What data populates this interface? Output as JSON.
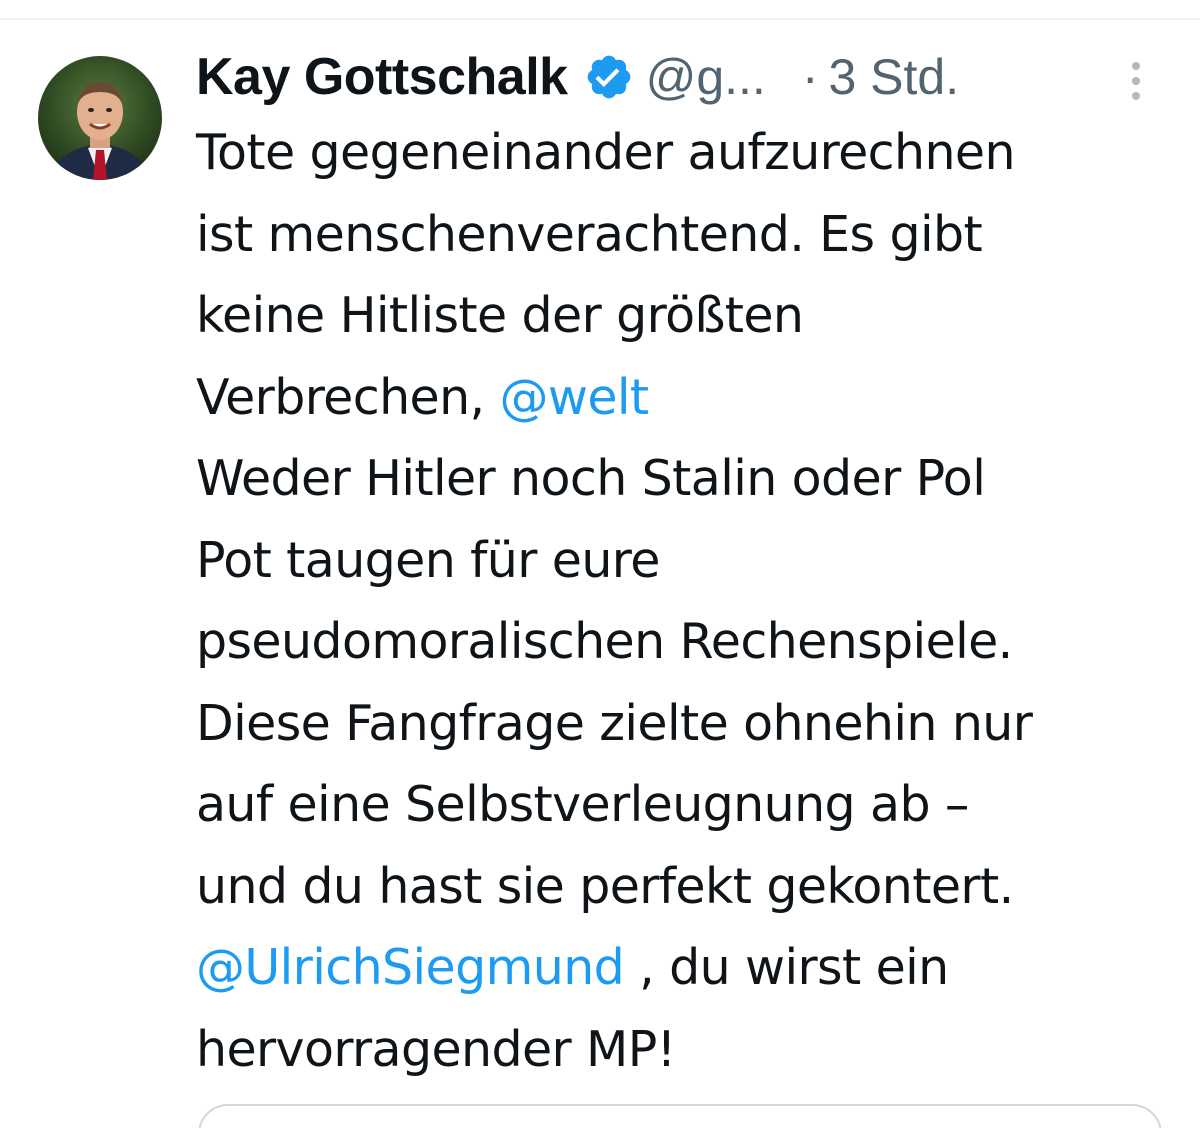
{
  "tweet": {
    "author": {
      "display_name": "Kay Gottschalk",
      "handle": "@g...",
      "avatar_icon": "profile-photo",
      "verified_icon": "verified-badge-icon"
    },
    "separator": "·",
    "timestamp": "3 Std.",
    "text": {
      "line1": "Tote gegeneinander aufzurechnen",
      "line2": "ist menschenverachtend. Es gibt",
      "line3": "keine Hitliste der größten",
      "line4_prefix": "Verbrechen, ",
      "mention_welt": "@welt",
      "line5": "Weder Hitler noch Stalin oder Pol",
      "line6": "Pot taugen für eure",
      "line7": "pseudomoralischen Rechenspiele.",
      "line8": "Diese Fangfrage zielte ohnehin nur",
      "line9": "auf eine Selbstverleugnung ab –",
      "line10": "und du hast sie perfekt gekontert.",
      "mention_ulrich": "@UlrichSiegmund",
      "line11_suffix": " , du wirst ein",
      "line12": "hervorragender MP!"
    }
  },
  "colors": {
    "text": "#0f1419",
    "secondary": "#536471",
    "link": "#1d9bf0",
    "verified": "#1d9bf0",
    "border": "#cfd9de"
  }
}
